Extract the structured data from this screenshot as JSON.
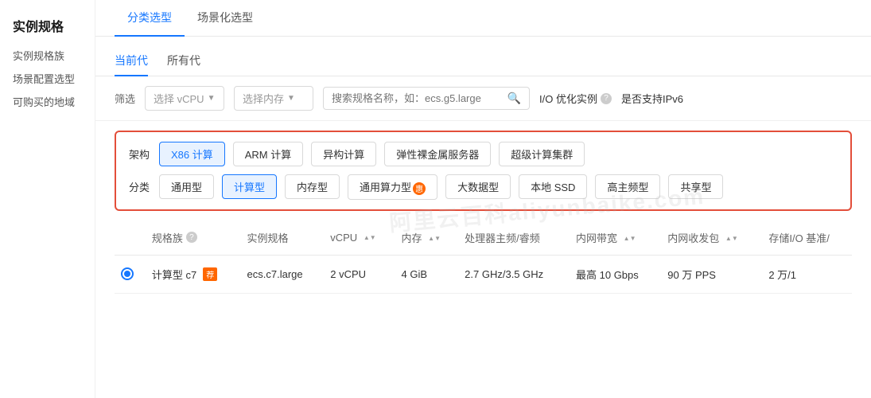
{
  "sidebar": {
    "title": "实例规格",
    "links": [
      "实例规格族",
      "场景配置选型",
      "可购买的地域"
    ]
  },
  "topTabs": [
    {
      "label": "分类选型",
      "active": true
    },
    {
      "label": "场景化选型",
      "active": false
    }
  ],
  "subTabs": [
    {
      "label": "当前代",
      "active": true
    },
    {
      "label": "所有代",
      "active": false
    }
  ],
  "filter": {
    "label": "筛选",
    "vcpu": {
      "placeholder": "选择 vCPU",
      "value": ""
    },
    "memory": {
      "placeholder": "选择内存",
      "value": ""
    },
    "search": {
      "placeholder": "搜索规格名称，如：ecs.g5.large",
      "value": ""
    },
    "io": "I/O 优化实例",
    "ipv6": "是否支持IPv6"
  },
  "selectionBox": {
    "architecture": {
      "label": "架构",
      "options": [
        {
          "label": "X86 计算",
          "active": true
        },
        {
          "label": "ARM 计算",
          "active": false
        },
        {
          "label": "异构计算",
          "active": false
        },
        {
          "label": "弹性裸金属服务器",
          "active": false
        },
        {
          "label": "超级计算集群",
          "active": false
        }
      ]
    },
    "category": {
      "label": "分类",
      "options": [
        {
          "label": "通用型",
          "active": false,
          "badge": false
        },
        {
          "label": "计算型",
          "active": true,
          "badge": false
        },
        {
          "label": "内存型",
          "active": false,
          "badge": false
        },
        {
          "label": "通用算力型",
          "active": false,
          "badge": true,
          "badgeText": "惠"
        },
        {
          "label": "大数据型",
          "active": false,
          "badge": false
        },
        {
          "label": "本地 SSD",
          "active": false,
          "badge": false
        },
        {
          "label": "高主频型",
          "active": false,
          "badge": false
        },
        {
          "label": "共享型",
          "active": false,
          "badge": false
        }
      ]
    }
  },
  "table": {
    "columns": [
      {
        "label": "",
        "sortable": false
      },
      {
        "label": "规格族",
        "sortable": false,
        "hasInfo": true
      },
      {
        "label": "实例规格",
        "sortable": false
      },
      {
        "label": "vCPU",
        "sortable": true
      },
      {
        "label": "内存",
        "sortable": true
      },
      {
        "label": "处理器主频/睿频",
        "sortable": false
      },
      {
        "label": "内网带宽",
        "sortable": true
      },
      {
        "label": "内网收发包",
        "sortable": true
      },
      {
        "label": "存储I/O 基准/",
        "sortable": false
      }
    ],
    "rows": [
      {
        "selected": true,
        "family": "计算型 c7",
        "familyBadge": "荐",
        "spec": "ecs.c7.large",
        "vcpu": "2 vCPU",
        "memory": "4 GiB",
        "freq": "2.7 GHz/3.5 GHz",
        "bandwidth": "最高 10 Gbps",
        "pps": "90 万 PPS",
        "storage": "2 万/1"
      }
    ]
  },
  "watermark": "阿里云百科aliyunbaike.com"
}
